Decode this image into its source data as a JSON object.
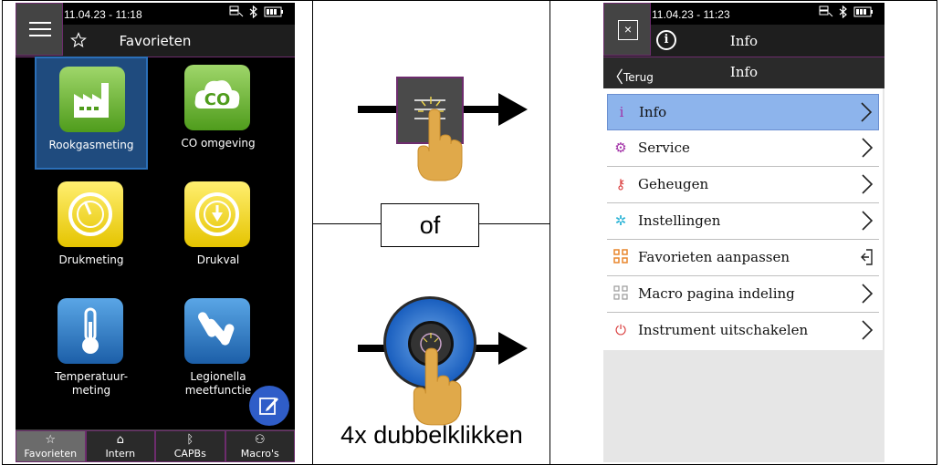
{
  "panel_left": {
    "time": "11.04.23 - 11:18",
    "title": "Favorieten",
    "tiles": [
      {
        "label": "Rookgasmeting",
        "icon": "factory-icon"
      },
      {
        "label": "CO omgeving",
        "icon": "co-cloud-icon"
      },
      {
        "label": "Drukmeting",
        "icon": "pressure-gauge-icon"
      },
      {
        "label": "Drukval",
        "icon": "pressure-drop-gauge-icon"
      },
      {
        "label": "Temperatuur-\nmeting",
        "icon": "thermometer-icon"
      },
      {
        "label": "Legionella\nmeetfunctie",
        "icon": "legionella-icon"
      }
    ],
    "bottom_nav": [
      {
        "label": "Favorieten",
        "icon": "star-icon"
      },
      {
        "label": "Intern",
        "icon": "home-icon"
      },
      {
        "label": "CAPBs",
        "icon": "bluetooth-icon"
      },
      {
        "label": "Macro's",
        "icon": "user-icon"
      }
    ]
  },
  "panel_middle": {
    "or_label": "of",
    "caption": "4x dubbelklikken"
  },
  "panel_right": {
    "time": "11.04.23 - 11:23",
    "title": "Info",
    "back_label": "Terug",
    "subtitle": "Info",
    "items": [
      {
        "label": "Info",
        "icon": "info-icon"
      },
      {
        "label": "Service",
        "icon": "gears-icon"
      },
      {
        "label": "Geheugen",
        "icon": "key-icon"
      },
      {
        "label": "Instellingen",
        "icon": "settings-icon"
      },
      {
        "label": "Favorieten aanpassen",
        "icon": "grid-icon"
      },
      {
        "label": "Macro pagina indeling",
        "icon": "grid-outline-icon"
      },
      {
        "label": "Instrument uitschakelen",
        "icon": "power-icon"
      }
    ]
  },
  "colors": {
    "accent_selected_tile": "#1f4b7e",
    "selected_row": "#8db4ec",
    "border_purple": "#6d2c6d"
  }
}
